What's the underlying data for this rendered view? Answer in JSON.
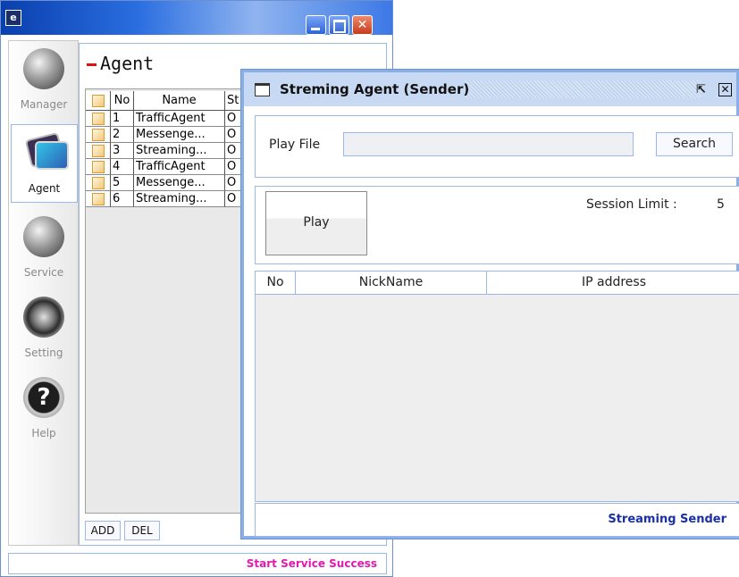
{
  "sidebar": {
    "items": [
      {
        "label": "Manager",
        "icon": "globe-icon"
      },
      {
        "label": "Agent",
        "icon": "screens-icon"
      },
      {
        "label": "Service",
        "icon": "device-globe-icon"
      },
      {
        "label": "Setting",
        "icon": "gear-icon"
      },
      {
        "label": "Help",
        "icon": "help-icon"
      }
    ],
    "active": "Agent"
  },
  "agent_panel": {
    "title": "Agent",
    "table": {
      "headers": {
        "no": "No",
        "name": "Name",
        "status": "St"
      },
      "rows": [
        {
          "no": "1",
          "name": "TrafficAgent",
          "status": "O"
        },
        {
          "no": "2",
          "name": "Messenge...",
          "status": "O"
        },
        {
          "no": "3",
          "name": "Streaming...",
          "status": "O"
        },
        {
          "no": "4",
          "name": "TrafficAgent",
          "status": "O"
        },
        {
          "no": "5",
          "name": "Messenge...",
          "status": "O"
        },
        {
          "no": "6",
          "name": "Streaming...",
          "status": "O"
        }
      ]
    },
    "add_label": "ADD",
    "del_label": "DEL"
  },
  "main_status": "Start Service Success",
  "dialog": {
    "title": "Streming Agent (Sender)",
    "restore_glyph": "⇱",
    "close_glyph": "✕",
    "play_file_label": "Play File",
    "play_file_value": "",
    "search_label": "Search",
    "play_label": "Play",
    "session_limit_label": "Session Limit :",
    "session_limit_value": "5",
    "list_headers": {
      "no": "No",
      "nickname": "NickName",
      "ip": "IP address"
    },
    "status": "Streaming Sender"
  },
  "colors": {
    "accent_border": "#9bb8e6",
    "status_magenta": "#e01ab0",
    "status_blue": "#1a2fa8",
    "title_red_bar": "#e01010"
  }
}
